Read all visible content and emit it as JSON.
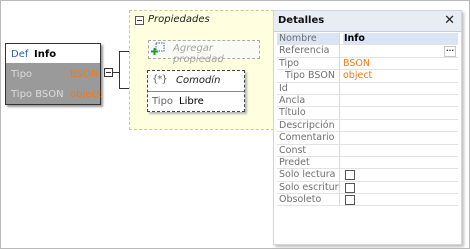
{
  "info_node": {
    "def_label": "Def",
    "title": "Info",
    "rows": [
      {
        "label": "Tipo",
        "value": "BSON"
      },
      {
        "label": "Tipo BSON",
        "value": "object"
      }
    ]
  },
  "propiedades": {
    "title": "Propiedades",
    "add_label": "Agregar propiedad",
    "wildcard": {
      "icon_text": "{*}",
      "title": "Comodín",
      "type_label": "Tipo",
      "type_value": "Libre"
    }
  },
  "details": {
    "title": "Detalles",
    "close_glyph": "✕",
    "dots": "...",
    "rows": [
      {
        "name": "Nombre",
        "value": "Info"
      },
      {
        "name": "Referencia",
        "value": ""
      },
      {
        "name": "Tipo",
        "value": "BSON"
      },
      {
        "name": "Tipo BSON",
        "value": "object"
      },
      {
        "name": "Id",
        "value": ""
      },
      {
        "name": "Ancla",
        "value": ""
      },
      {
        "name": "Título",
        "value": ""
      },
      {
        "name": "Descripción",
        "value": ""
      },
      {
        "name": "Comentario",
        "value": ""
      },
      {
        "name": "Const",
        "value": ""
      },
      {
        "name": "Predet",
        "value": ""
      },
      {
        "name": "Solo lectura",
        "value": ""
      },
      {
        "name": "Solo escritura",
        "value": ""
      },
      {
        "name": "Obsoleto",
        "value": ""
      }
    ]
  },
  "colors": {
    "accent_orange": "#f07a16",
    "def_blue": "#2a5db0",
    "group_fill": "#ffffdf"
  }
}
